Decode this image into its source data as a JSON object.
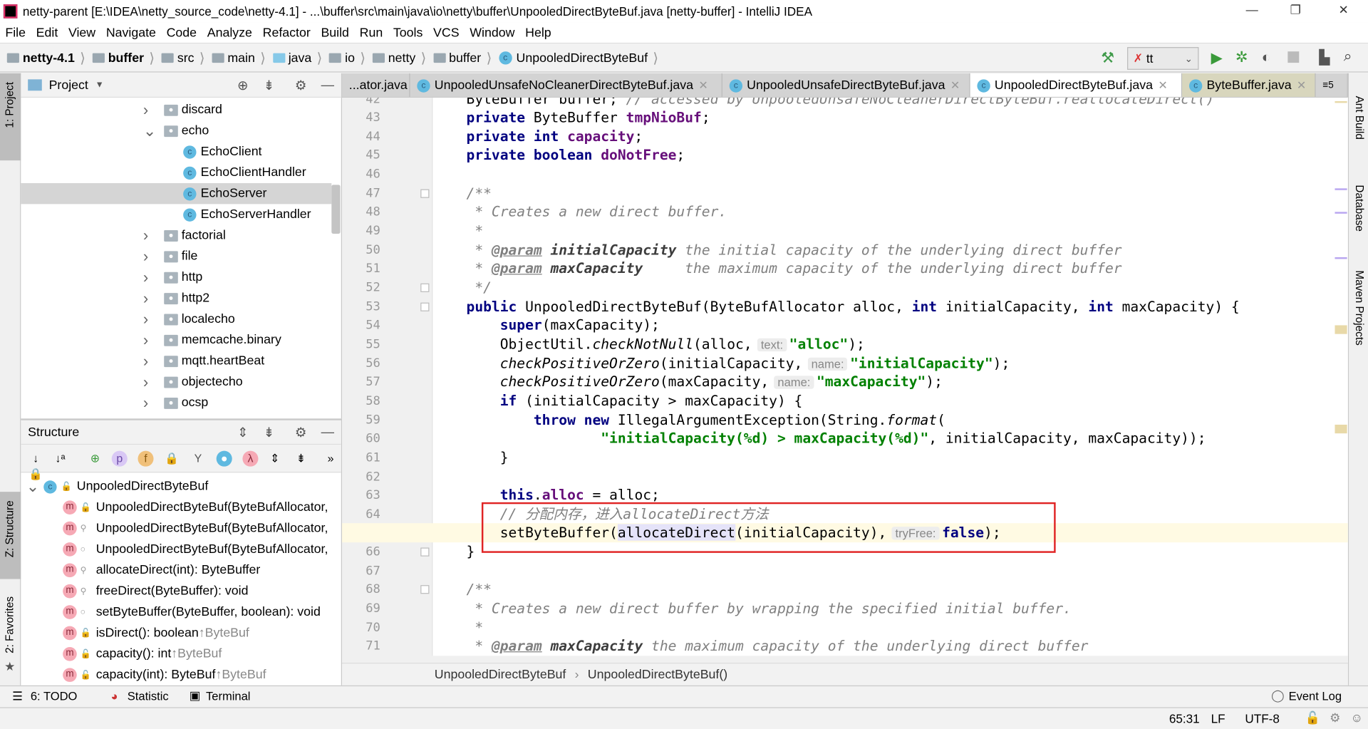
{
  "window": {
    "title": "netty-parent [E:\\IDEA\\netty_source_code\\netty-4.1] - ...\\buffer\\src\\main\\java\\io\\netty\\buffer\\UnpooledDirectByteBuf.java [netty-buffer] - IntelliJ IDEA"
  },
  "menu": [
    "File",
    "Edit",
    "View",
    "Navigate",
    "Code",
    "Analyze",
    "Refactor",
    "Build",
    "Run",
    "Tools",
    "VCS",
    "Window",
    "Help"
  ],
  "breadcrumbs": [
    "netty-4.1",
    "buffer",
    "src",
    "main",
    "java",
    "io",
    "netty",
    "buffer",
    "UnpooledDirectByteBuf"
  ],
  "run_config": "tt",
  "left_stripe": {
    "project": "1: Project",
    "structure": "Z: Structure",
    "favorites": "2: Favorites"
  },
  "right_stripe": [
    "Ant Build",
    "Database",
    "Maven Projects"
  ],
  "project": {
    "title": "Project",
    "items": [
      {
        "label": "discard",
        "type": "folder",
        "level": 0,
        "expanded": false
      },
      {
        "label": "echo",
        "type": "folder",
        "level": 0,
        "expanded": true
      },
      {
        "label": "EchoClient",
        "type": "class-run",
        "level": 1
      },
      {
        "label": "EchoClientHandler",
        "type": "class",
        "level": 1
      },
      {
        "label": "EchoServer",
        "type": "class-run",
        "level": 1,
        "selected": true
      },
      {
        "label": "EchoServerHandler",
        "type": "class",
        "level": 1
      },
      {
        "label": "factorial",
        "type": "folder",
        "level": 0,
        "expanded": false
      },
      {
        "label": "file",
        "type": "folder",
        "level": 0,
        "expanded": false
      },
      {
        "label": "http",
        "type": "folder",
        "level": 0,
        "expanded": false
      },
      {
        "label": "http2",
        "type": "folder",
        "level": 0,
        "expanded": false
      },
      {
        "label": "localecho",
        "type": "folder",
        "level": 0,
        "expanded": false
      },
      {
        "label": "memcache.binary",
        "type": "folder",
        "level": 0,
        "expanded": false
      },
      {
        "label": "mqtt.heartBeat",
        "type": "folder",
        "level": 0,
        "expanded": false
      },
      {
        "label": "objectecho",
        "type": "folder",
        "level": 0,
        "expanded": false
      },
      {
        "label": "ocsp",
        "type": "folder",
        "level": 0,
        "expanded": false
      }
    ]
  },
  "structure": {
    "title": "Structure",
    "root": "UnpooledDirectByteBuf",
    "items": [
      {
        "label": "UnpooledDirectByteBuf(ByteBufAllocator,",
        "vis": "public"
      },
      {
        "label": "UnpooledDirectByteBuf(ByteBufAllocator,",
        "vis": "protected"
      },
      {
        "label": "UnpooledDirectByteBuf(ByteBufAllocator,",
        "vis": "package"
      },
      {
        "label": "allocateDirect(int): ByteBuffer",
        "vis": "protected"
      },
      {
        "label": "freeDirect(ByteBuffer): void",
        "vis": "protected"
      },
      {
        "label": "setByteBuffer(ByteBuffer, boolean): void",
        "vis": "package"
      },
      {
        "label": "isDirect(): boolean",
        "vis": "public",
        "inherit": "↑ByteBuf"
      },
      {
        "label": "capacity(): int",
        "vis": "public",
        "inherit": "↑ByteBuf"
      },
      {
        "label": "capacity(int): ByteBuf",
        "vis": "public",
        "inherit": "↑ByteBuf"
      }
    ]
  },
  "tabs": [
    {
      "label": "...ator.java",
      "active": false
    },
    {
      "label": "UnpooledUnsafeNoCleanerDirectByteBuf.java",
      "active": false
    },
    {
      "label": "UnpooledUnsafeDirectByteBuf.java",
      "active": false
    },
    {
      "label": "UnpooledDirectByteBuf.java",
      "active": true
    },
    {
      "label": "ByteBuffer.java",
      "active": false
    },
    {
      "label": "5",
      "overflow": true
    }
  ],
  "code": {
    "current_line": 65,
    "lines": [
      {
        "n": 42,
        "tokens": [
          [
            "p",
            "    ByteBuffer buffer; "
          ],
          [
            "cmt",
            "// accessed by UnpooledUnsafeNoCleanerDirectByteBuf.reallocateDirect()"
          ]
        ]
      },
      {
        "n": 43,
        "tokens": [
          [
            "kw",
            "    private "
          ],
          [
            "p",
            "ByteBuffer "
          ],
          [
            "fld",
            "tmpNioBuf"
          ],
          [
            "p",
            ";"
          ]
        ]
      },
      {
        "n": 44,
        "tokens": [
          [
            "kw",
            "    private int "
          ],
          [
            "fld",
            "capacity"
          ],
          [
            "p",
            ";"
          ]
        ]
      },
      {
        "n": 45,
        "tokens": [
          [
            "kw",
            "    private boolean "
          ],
          [
            "fld",
            "doNotFree"
          ],
          [
            "p",
            ";"
          ]
        ]
      },
      {
        "n": 46,
        "tokens": []
      },
      {
        "n": 47,
        "tokens": [
          [
            "cmt",
            "    /**"
          ]
        ]
      },
      {
        "n": 48,
        "tokens": [
          [
            "cmt",
            "     * Creates a new direct buffer."
          ]
        ]
      },
      {
        "n": 49,
        "tokens": [
          [
            "cmt",
            "     *"
          ]
        ]
      },
      {
        "n": 50,
        "tokens": [
          [
            "cmt",
            "     * "
          ],
          [
            "doctag",
            "@param"
          ],
          [
            "cmt",
            " "
          ],
          [
            "docparam",
            "initialCapacity"
          ],
          [
            "cmt",
            " the initial capacity of the underlying direct buffer"
          ]
        ]
      },
      {
        "n": 51,
        "tokens": [
          [
            "cmt",
            "     * "
          ],
          [
            "doctag",
            "@param"
          ],
          [
            "cmt",
            " "
          ],
          [
            "docparam",
            "maxCapacity"
          ],
          [
            "cmt",
            "     the maximum capacity of the underlying direct buffer"
          ]
        ]
      },
      {
        "n": 52,
        "tokens": [
          [
            "cmt",
            "     */"
          ]
        ]
      },
      {
        "n": 53,
        "tokens": [
          [
            "kw",
            "    public "
          ],
          [
            "p",
            "UnpooledDirectByteBuf(ByteBufAllocator alloc, "
          ],
          [
            "kw",
            "int "
          ],
          [
            "p",
            "initialCapacity, "
          ],
          [
            "kw",
            "int "
          ],
          [
            "p",
            "maxCapacity) {"
          ]
        ]
      },
      {
        "n": 54,
        "tokens": [
          [
            "kw",
            "        super"
          ],
          [
            "p",
            "(maxCapacity);"
          ]
        ]
      },
      {
        "n": 55,
        "tokens": [
          [
            "p",
            "        ObjectUtil."
          ],
          [
            "ital",
            "checkNotNull"
          ],
          [
            "p",
            "(alloc,"
          ],
          [
            "hint",
            "text:"
          ],
          [
            "str",
            "\"alloc\""
          ],
          [
            "p",
            ");"
          ]
        ]
      },
      {
        "n": 56,
        "tokens": [
          [
            "ital",
            "        checkPositiveOrZero"
          ],
          [
            "p",
            "(initialCapacity,"
          ],
          [
            "hint",
            "name:"
          ],
          [
            "str",
            "\"initialCapacity\""
          ],
          [
            "p",
            ");"
          ]
        ]
      },
      {
        "n": 57,
        "tokens": [
          [
            "ital",
            "        checkPositiveOrZero"
          ],
          [
            "p",
            "(maxCapacity,"
          ],
          [
            "hint",
            "name:"
          ],
          [
            "str",
            "\"maxCapacity\""
          ],
          [
            "p",
            ");"
          ]
        ]
      },
      {
        "n": 58,
        "tokens": [
          [
            "kw",
            "        if "
          ],
          [
            "p",
            "(initialCapacity > maxCapacity) {"
          ]
        ]
      },
      {
        "n": 59,
        "tokens": [
          [
            "kw",
            "            throw new "
          ],
          [
            "p",
            "IllegalArgumentException(String."
          ],
          [
            "ital",
            "format"
          ],
          [
            "p",
            "("
          ]
        ]
      },
      {
        "n": 60,
        "tokens": [
          [
            "p",
            "                    "
          ],
          [
            "str",
            "\"initialCapacity(%d) > maxCapacity(%d)\""
          ],
          [
            "p",
            ", initialCapacity, maxCapacity));"
          ]
        ]
      },
      {
        "n": 61,
        "tokens": [
          [
            "p",
            "        }"
          ]
        ]
      },
      {
        "n": 62,
        "tokens": []
      },
      {
        "n": 63,
        "tokens": [
          [
            "kw",
            "        this"
          ],
          [
            "p",
            "."
          ],
          [
            "fld",
            "alloc"
          ],
          [
            "p",
            " = alloc;"
          ]
        ]
      },
      {
        "n": 64,
        "tokens": [
          [
            "cmt",
            "        // 分配内存，进入allocateDirect方法"
          ]
        ]
      },
      {
        "n": 65,
        "tokens": [
          [
            "p",
            "        setByteBuffer("
          ],
          [
            "hl",
            "allocateDirect"
          ],
          [
            "p",
            "(initialCapacity),"
          ],
          [
            "hint",
            "tryFree:"
          ],
          [
            "kw",
            "false"
          ],
          [
            "p",
            ");"
          ]
        ]
      },
      {
        "n": 66,
        "tokens": [
          [
            "p",
            "    }"
          ]
        ]
      },
      {
        "n": 67,
        "tokens": []
      },
      {
        "n": 68,
        "tokens": [
          [
            "cmt",
            "    /**"
          ]
        ]
      },
      {
        "n": 69,
        "tokens": [
          [
            "cmt",
            "     * Creates a new direct buffer by wrapping the specified initial buffer."
          ]
        ]
      },
      {
        "n": 70,
        "tokens": [
          [
            "cmt",
            "     *"
          ]
        ]
      },
      {
        "n": 71,
        "tokens": [
          [
            "cmt",
            "     * "
          ],
          [
            "doctag",
            "@param"
          ],
          [
            "cmt",
            " "
          ],
          [
            "docparam",
            "maxCapacity"
          ],
          [
            "cmt",
            " the maximum capacity of the underlying direct buffer"
          ]
        ]
      },
      {
        "n": 72,
        "tokens": [
          [
            "cmt",
            "     * ..."
          ]
        ]
      }
    ]
  },
  "editor_breadcrumb": [
    "UnpooledDirectByteBuf",
    "UnpooledDirectByteBuf()"
  ],
  "bottom_tools": {
    "todo": "6: TODO",
    "statistic": "Statistic",
    "terminal": "Terminal",
    "event_log": "Event Log"
  },
  "status": {
    "position": "65:31",
    "line_sep": "LF",
    "encoding": "UTF-8"
  },
  "colors": {
    "keyword": "#000080",
    "field": "#660e7a",
    "string": "#008000",
    "comment": "#808080",
    "highlight_box": "#e02424",
    "current_line": "#fffae3"
  }
}
